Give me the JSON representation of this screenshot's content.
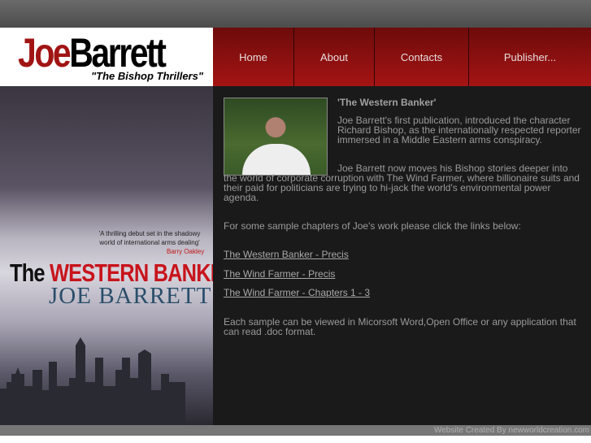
{
  "logo": {
    "first": "Joe",
    "last": "Barrett",
    "tagline": "\"The Bishop Thrillers\""
  },
  "nav": [
    {
      "label": "Home"
    },
    {
      "label": "About"
    },
    {
      "label": "Contacts"
    },
    {
      "label": "Publisher..."
    }
  ],
  "cover": {
    "quote": "'A thrilling debut set in the shadowy world of international arms dealing'",
    "quote_by": "Barry Oakley",
    "title_the": "The",
    "title_main": "WESTERN BANKER",
    "author": "JOE BARRETT"
  },
  "main": {
    "heading": "'The Western Banker'",
    "para1": "Joe Barrett's first publication, introduced the character Richard Bishop, as the internationally respected reporter immersed in a Middle Eastern arms conspiracy.",
    "para2": "Joe Barrett now moves his Bishop stories deeper into the world of corporate corruption with The Wind Farmer, where billionaire suits and their paid for politicians are trying to hi-jack the world's environmental power agenda.",
    "para3": "For some sample chapters of Joe's work please click the links below:",
    "links": [
      {
        "label": "The Western Banker - Precis"
      },
      {
        "label": "The Wind Farmer - Precis"
      },
      {
        "label": "The Wind Farmer - Chapters 1 - 3"
      }
    ],
    "para4": "Each sample can be viewed in Micorsoft Word,Open Office or any application that can read .doc format."
  },
  "footer": {
    "credit": "Website Created By newworldcreation.com"
  }
}
